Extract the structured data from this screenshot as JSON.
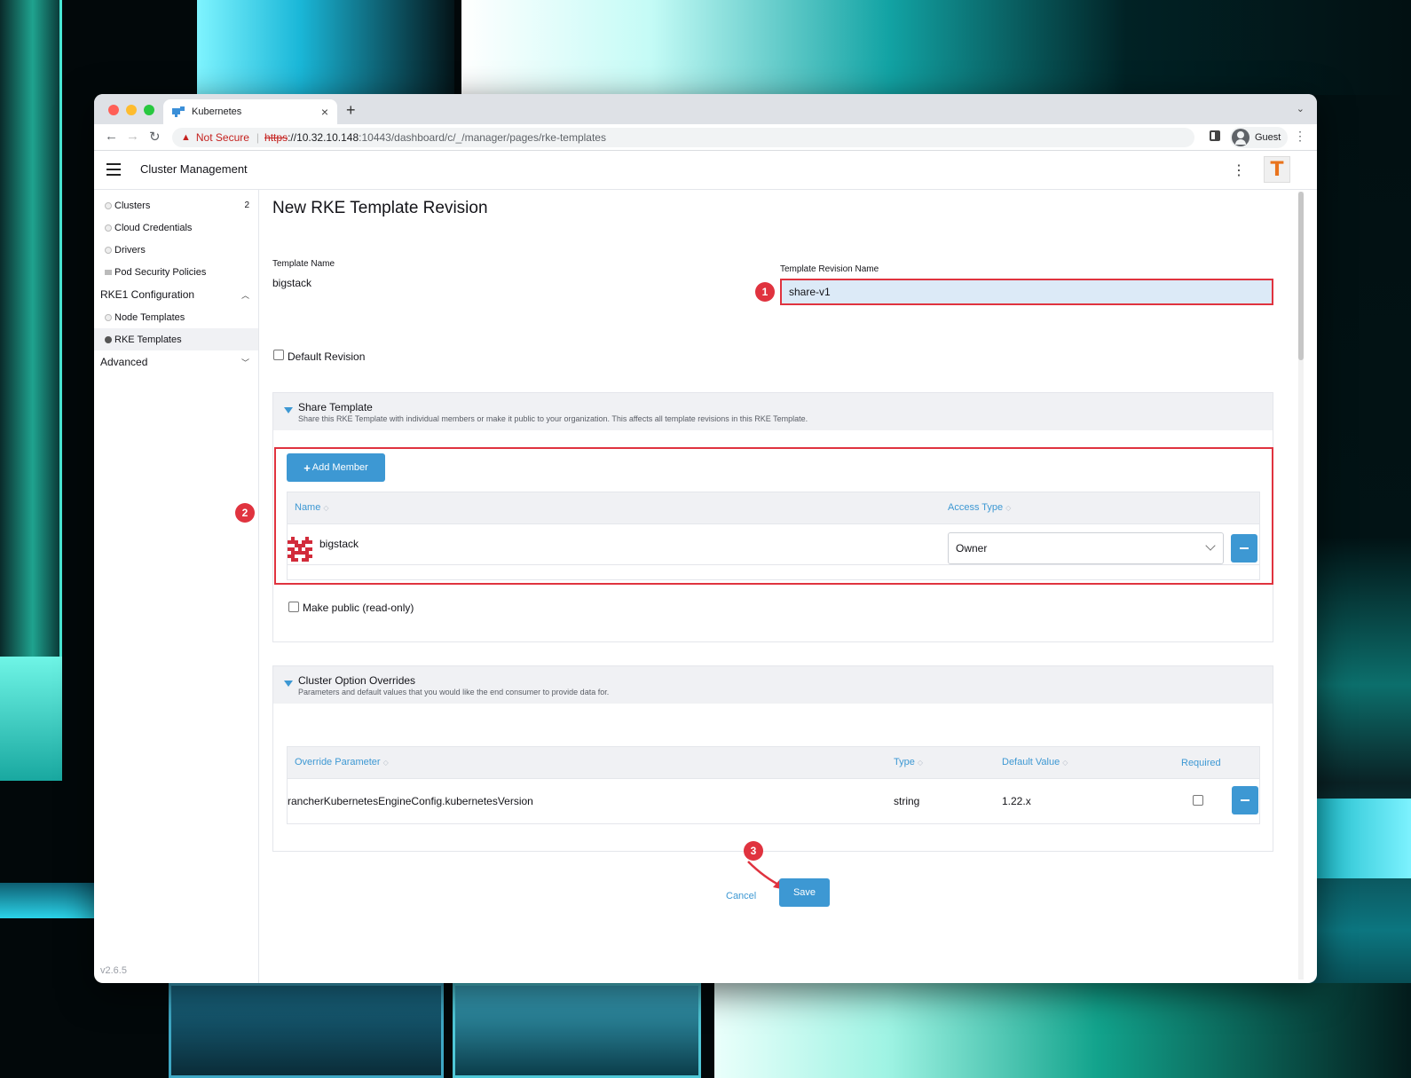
{
  "browser": {
    "tab_title": "Kubernetes",
    "security_label": "Not Secure",
    "url_scheme": "https",
    "url_host": "://10.32.10.148",
    "url_path": ":10443/dashboard/c/_/manager/pages/rke-templates",
    "profile_label": "Guest"
  },
  "app": {
    "title": "Cluster Management",
    "logo_letter": "T",
    "version": "v2.6.5"
  },
  "nav": {
    "items": [
      {
        "label": "Clusters",
        "count": "2"
      },
      {
        "label": "Cloud Credentials"
      },
      {
        "label": "Drivers"
      },
      {
        "label": "Pod Security Policies"
      }
    ],
    "group_rke1": "RKE1 Configuration",
    "rke1_items": [
      {
        "label": "Node Templates"
      },
      {
        "label": "RKE Templates"
      }
    ],
    "group_advanced": "Advanced"
  },
  "page": {
    "title": "New RKE Template Revision",
    "template_name_label": "Template Name",
    "template_name_value": "bigstack",
    "revision_name_label": "Template Revision Name",
    "revision_name_value": "share-v1",
    "default_revision_label": "Default Revision"
  },
  "share": {
    "title": "Share Template",
    "description": "Share this RKE Template with individual members or make it public to your organization. This affects all template revisions in this RKE Template.",
    "add_member_label": "Add Member",
    "col_name": "Name",
    "col_access": "Access Type",
    "members": [
      {
        "name": "bigstack",
        "access": "Owner"
      }
    ],
    "make_public_label": "Make public (read-only)"
  },
  "overrides": {
    "title": "Cluster Option Overrides",
    "description": "Parameters and default values that you would like the end consumer to provide data for.",
    "col_param": "Override Parameter",
    "col_type": "Type",
    "col_default": "Default Value",
    "col_required": "Required",
    "rows": [
      {
        "param": "rancherKubernetesEngineConfig.kubernetesVersion",
        "type": "string",
        "default": "1.22.x",
        "required": false
      }
    ]
  },
  "footer": {
    "cancel_label": "Cancel",
    "save_label": "Save"
  },
  "annotations": [
    "1",
    "2",
    "3"
  ],
  "colors": {
    "accent": "#3d98d3",
    "highlight": "#e0333f"
  }
}
